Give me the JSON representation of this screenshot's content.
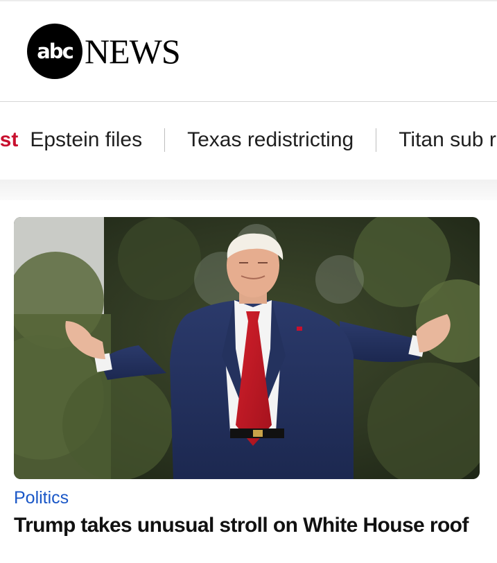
{
  "header": {
    "logo_abc": "abc",
    "logo_news": "NEWS"
  },
  "trending": {
    "label": "est",
    "items": [
      "Epstein files",
      "Texas redistricting",
      "Titan sub r"
    ],
    "label_color": "#c8102e"
  },
  "story": {
    "category": "Politics",
    "headline": "Trump takes unusual stroll on White House roof",
    "category_color": "#1a57c7",
    "image_alt": "Man in navy suit and red tie with arms outstretched in front of trees"
  }
}
